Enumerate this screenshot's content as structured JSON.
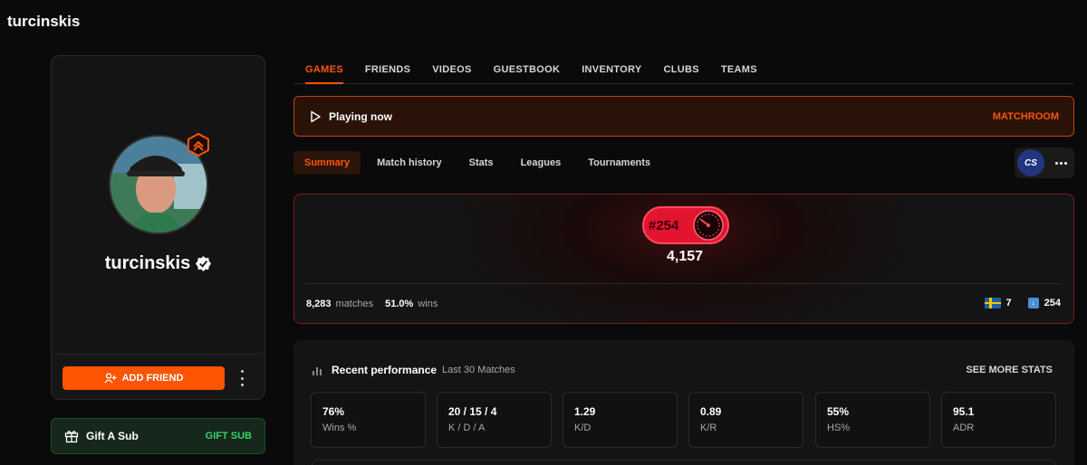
{
  "page": {
    "title": "turcinskis"
  },
  "profile": {
    "name": "turcinskis",
    "add_friend_label": "ADD FRIEND",
    "gift_label": "Gift A Sub",
    "gift_action": "GIFT SUB"
  },
  "tabs": [
    {
      "label": "GAMES",
      "active": true
    },
    {
      "label": "FRIENDS"
    },
    {
      "label": "VIDEOS"
    },
    {
      "label": "GUESTBOOK"
    },
    {
      "label": "INVENTORY"
    },
    {
      "label": "CLUBS"
    },
    {
      "label": "TEAMS"
    }
  ],
  "playing": {
    "label": "Playing now",
    "action": "MATCHROOM"
  },
  "subtabs": [
    {
      "label": "Summary",
      "active": true
    },
    {
      "label": "Match history"
    },
    {
      "label": "Stats"
    },
    {
      "label": "Leagues"
    },
    {
      "label": "Tournaments"
    }
  ],
  "game_logo": "CS",
  "elo": {
    "rank": "#254",
    "value": "4,157",
    "matches_value": "8,283",
    "matches_label": "matches",
    "wins_value": "51.0%",
    "wins_label": "wins",
    "country_rank": "7",
    "region_rank": "254"
  },
  "performance": {
    "title": "Recent performance",
    "subtitle": "Last 30 Matches",
    "see_more": "SEE MORE STATS",
    "stats": [
      {
        "value": "76%",
        "label": "Wins %"
      },
      {
        "value": "20 / 15 / 4",
        "label": "K / D / A"
      },
      {
        "value": "1.29",
        "label": "K/D"
      },
      {
        "value": "0.89",
        "label": "K/R"
      },
      {
        "value": "55%",
        "label": "HS%"
      },
      {
        "value": "95.1",
        "label": "ADR"
      }
    ]
  },
  "colors": {
    "accent": "#ff5500",
    "elo_red": "#e3142f",
    "gift_green": "#3ad36b"
  }
}
